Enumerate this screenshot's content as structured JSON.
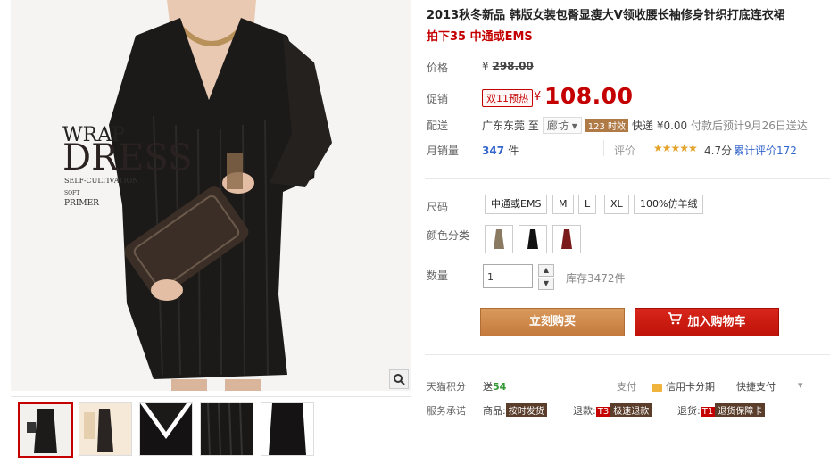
{
  "product": {
    "title": "2013秋冬新品 韩版女装包臀显瘦大V领收腰长袖修身针织打底连衣裙",
    "subtitle": "拍下35 中通或EMS"
  },
  "photo": {
    "overlay_line1": "WRAP",
    "overlay_line2": "DRESS",
    "overlay_line3": "SELF-CULTIVATION",
    "overlay_line4": "SOFT",
    "overlay_line5": "PRIMER"
  },
  "price": {
    "label": "价格",
    "currency": "¥",
    "original": "298.00"
  },
  "promo": {
    "label": "促销",
    "badge": "双11预热",
    "currency": "¥",
    "price": "108.00"
  },
  "shipping": {
    "label": "配送",
    "from": "广东东莞",
    "to_word": "至",
    "city": "廊坊",
    "timely_badge": "123 时效",
    "express_text": "快递 ¥0.00",
    "eta": "付款后预计9月26日送达"
  },
  "sales": {
    "label": "月销量",
    "count": "347",
    "unit": "件"
  },
  "review": {
    "label": "评价",
    "stars": "★★★★★",
    "score": "4.7分",
    "count_text": "累计评价172"
  },
  "size": {
    "label": "尺码",
    "options": [
      "中通或EMS",
      "M",
      "L",
      "XL",
      "100%仿羊绒"
    ]
  },
  "color": {
    "label": "颜色分类",
    "swatches": [
      "#8a7a62",
      "#111111",
      "#7a1a1a"
    ]
  },
  "quantity": {
    "label": "数量",
    "value": "1",
    "stock": "库存3472件"
  },
  "actions": {
    "buy_now": "立刻购买",
    "add_cart": "加入购物车"
  },
  "points": {
    "label": "天猫积分",
    "prefix": "送",
    "value": "54"
  },
  "payment": {
    "label": "支付",
    "credit": "信用卡分期",
    "quick": "快捷支付"
  },
  "service": {
    "label": "服务承诺",
    "goods_label": "商品:",
    "goods_tag": "按时发货",
    "refund_label": "退款:",
    "refund_code": "T3",
    "refund_tag": "极速退款",
    "return_label": "退货:",
    "return_code": "T1",
    "return_tag": "退货保障卡"
  }
}
